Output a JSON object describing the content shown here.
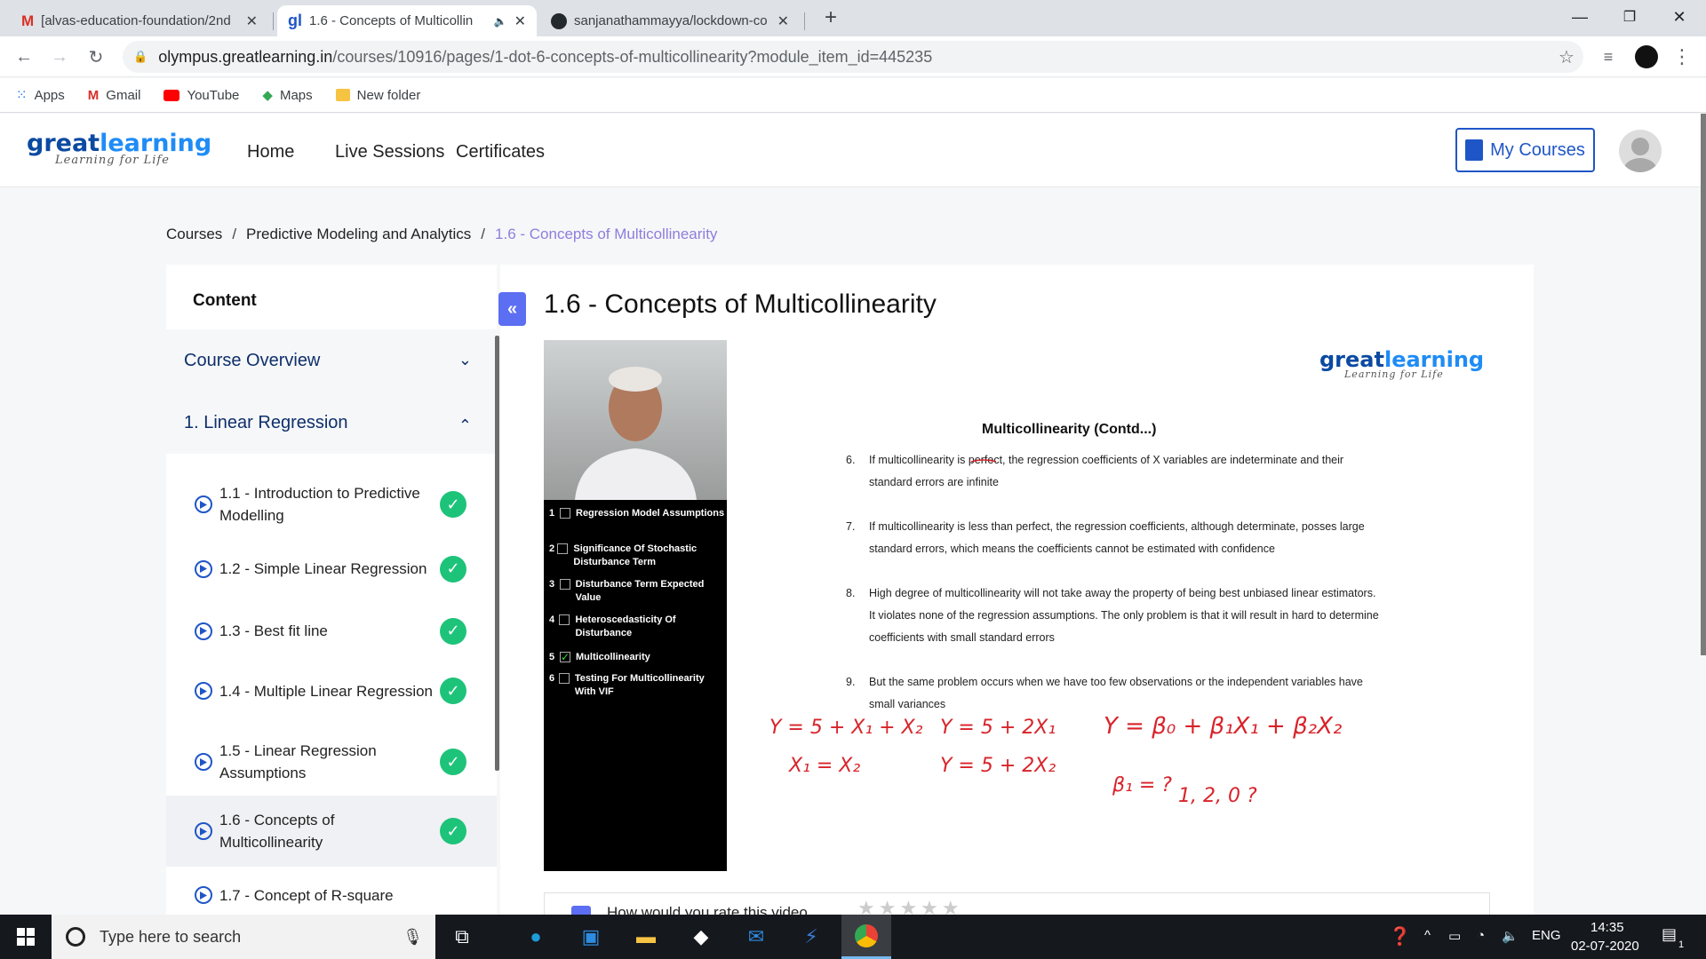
{
  "browser": {
    "tabs": [
      {
        "title": "[alvas-education-foundation/2nd",
        "icon": "gmail-icon"
      },
      {
        "title": "1.6 - Concepts of Multicollin",
        "icon": "greatlearning-icon",
        "audio": "speaker-icon"
      },
      {
        "title": "sanjanathammayya/lockdown-co",
        "icon": "github-icon"
      }
    ],
    "new_tab": "+",
    "url_host": "olympus.greatlearning.in",
    "url_path": "/courses/10916/pages/1-dot-6-concepts-of-multicollinearity?module_item_id=445235",
    "bookmarks": [
      {
        "label": "Apps",
        "icon": "apps-grid-icon",
        "color": "#1a73e8"
      },
      {
        "label": "Gmail",
        "icon": "gmail-icon",
        "color": "#d93025"
      },
      {
        "label": "YouTube",
        "icon": "youtube-icon",
        "color": "#ff0000"
      },
      {
        "label": "Maps",
        "icon": "maps-icon",
        "color": "#34a853"
      },
      {
        "label": "New folder",
        "icon": "folder-icon",
        "color": "#f6c343"
      }
    ]
  },
  "site": {
    "logo_great": "great",
    "logo_learning": "learning",
    "logo_tagline": "Learning for Life",
    "nav": [
      "Home",
      "Live Sessions",
      "Certificates"
    ],
    "my_courses": "My Courses",
    "accent": "#1f56c7"
  },
  "breadcrumb": [
    "Courses",
    "Predictive Modeling and Analytics",
    "1.6 - Concepts of Multicollinearity"
  ],
  "sidebar": {
    "heading": "Content",
    "sections": [
      {
        "label": "Course Overview",
        "expanded": false
      },
      {
        "label": "1. Linear Regression",
        "expanded": true
      }
    ],
    "items": [
      {
        "label": "1.1 - Introduction to Predictive Modelling",
        "done": true
      },
      {
        "label": "1.2 - Simple Linear Regression",
        "done": true
      },
      {
        "label": "1.3 - Best fit line",
        "done": true
      },
      {
        "label": "1.4 - Multiple Linear Regression",
        "done": true
      },
      {
        "label": "1.5 - Linear Regression Assumptions",
        "done": true
      },
      {
        "label": "1.6 - Concepts of Multicollinearity",
        "done": true,
        "selected": true
      },
      {
        "label": "1.7 - Concept of R-square",
        "done": false
      }
    ]
  },
  "main": {
    "title": "1.6 - Concepts of Multicollinearity",
    "video": {
      "topics": [
        {
          "n": "1",
          "label": "Regression Model Assumptions",
          "checked": false
        },
        {
          "n": "2",
          "label": "Significance Of Stochastic Disturbance Term",
          "checked": false
        },
        {
          "n": "3",
          "label": "Disturbance Term Expected Value",
          "checked": false
        },
        {
          "n": "4",
          "label": "Heteroscedasticity Of Disturbance",
          "checked": false
        },
        {
          "n": "5",
          "label": "Multicollinearity",
          "checked": true
        },
        {
          "n": "6",
          "label": "Testing For Multicollinearity With VIF",
          "checked": false
        }
      ],
      "slide_logo_great": "great",
      "slide_logo_learning": "learning",
      "slide_logo_tagline": "Learning for Life",
      "slide_title": "Multicollinearity (Contd...)",
      "points": [
        {
          "n": "6.",
          "text": "If multicollinearity is perfect, the regression coefficients of X variables are indeterminate and their standard errors are infinite"
        },
        {
          "n": "7.",
          "text": "If multicollinearity is less than perfect, the regression coefficients, although determinate, posses large standard errors, which means the coefficients cannot be estimated with confidence"
        },
        {
          "n": "8.",
          "text": "High degree of multicollinearity will not take away the property of being best unbiased linear estimators. It violates none of the regression assumptions. The only problem is that it will result in hard to determine coefficients with small standard errors"
        },
        {
          "n": "9.",
          "text": "But the same problem occurs when we have too few observations or the independent variables have small variances"
        }
      ],
      "ink": {
        "eq1": "Y = 5 + X₁ + X₂",
        "eq2": "X₁ = X₂",
        "eq3": "Y = 5 + 2X₁",
        "eq4": "Y = 5 + 2X₂",
        "eq5": "Y = β₀ + β₁X₁ + β₂X₂",
        "eq6": "β₁ = ?",
        "eq7": "1, 2, 0 ?",
        "color": "#d8232a"
      }
    },
    "rating_prompt": "How would you rate this video",
    "stars": "★★★★★"
  },
  "taskbar": {
    "search_placeholder": "Type here to search",
    "lang": "ENG",
    "time": "14:35",
    "date": "02-07-2020",
    "notifications": "1"
  }
}
